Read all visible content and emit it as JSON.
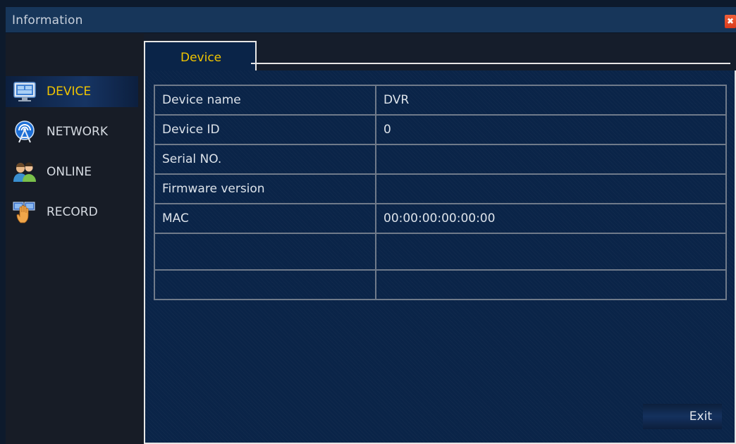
{
  "window": {
    "title": "Information"
  },
  "sidebar": {
    "items": [
      {
        "label": "DEVICE",
        "icon": "monitor-icon",
        "active": true
      },
      {
        "label": "NETWORK",
        "icon": "antenna-icon",
        "active": false
      },
      {
        "label": "ONLINE",
        "icon": "users-icon",
        "active": false
      },
      {
        "label": "RECORD",
        "icon": "record-hand-icon",
        "active": false
      }
    ]
  },
  "tabs": [
    {
      "label": "Device",
      "active": true
    }
  ],
  "device_info": {
    "rows": [
      {
        "key": "Device name",
        "value": "DVR"
      },
      {
        "key": "Device ID",
        "value": "0"
      },
      {
        "key": "Serial NO.",
        "value": ""
      },
      {
        "key": "Firmware version",
        "value": ""
      },
      {
        "key": "MAC",
        "value": "00:00:00:00:00:00"
      },
      {
        "key": "",
        "value": ""
      },
      {
        "key": "",
        "value": ""
      }
    ]
  },
  "footer": {
    "exit_label": "Exit"
  },
  "colors": {
    "accent": "#f0c400",
    "panel": "#0a2448",
    "titlebar": "#17365a"
  }
}
